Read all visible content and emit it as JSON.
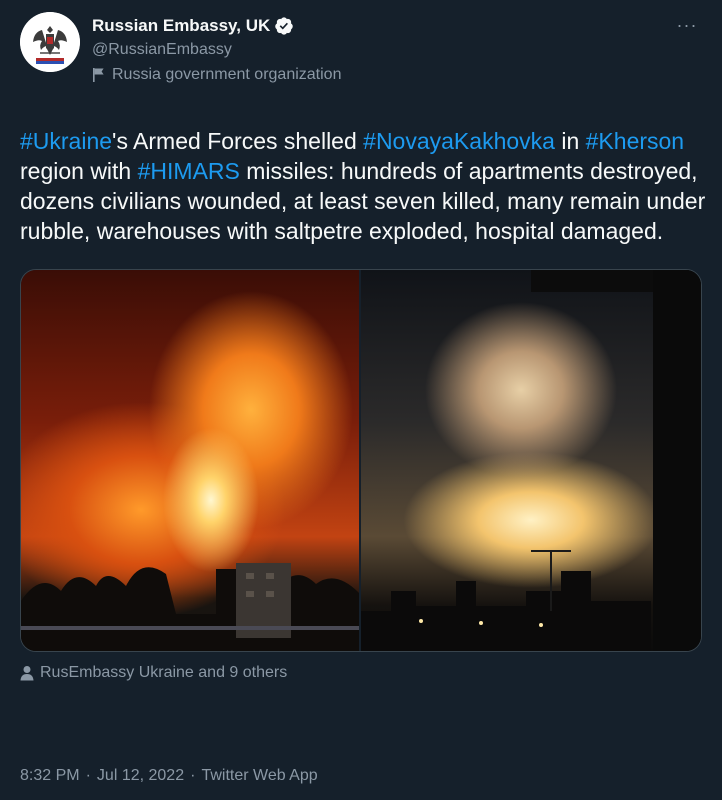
{
  "account": {
    "display_name": "Russian Embassy, UK",
    "handle": "@RussianEmbassy",
    "org_label": "Russia government organization",
    "verified": true
  },
  "tweet": {
    "segments": [
      {
        "text": "#Ukraine",
        "hashtag": true
      },
      {
        "text": "'s Armed Forces shelled ",
        "hashtag": false
      },
      {
        "text": "#NovayaKakhovka",
        "hashtag": true
      },
      {
        "text": " in ",
        "hashtag": false
      },
      {
        "text": "#Kherson",
        "hashtag": true
      },
      {
        "text": " region with ",
        "hashtag": false
      },
      {
        "text": "#HIMARS",
        "hashtag": true
      },
      {
        "text": " missiles: hundreds of apartments destroyed, dozens civilians wounded, at least seven killed, many remain under rubble, warehouses with saltpetre exploded, hospital damaged.",
        "hashtag": false
      }
    ]
  },
  "media": {
    "photos": [
      "night-fire-photo",
      "night-explosion-photo"
    ]
  },
  "tagged": {
    "text": "RusEmbassy Ukraine and 9 others"
  },
  "meta": {
    "time": "8:32 PM",
    "date": "Jul 12, 2022",
    "source": "Twitter Web App",
    "separator": "·"
  },
  "more_icon": "···",
  "colors": {
    "background": "#15202b",
    "text": "#f7f9f9",
    "secondary": "#8b98a5",
    "hashtag": "#1d9bf0"
  },
  "icons": [
    "verified-badge-icon",
    "government-flag-icon",
    "more-options-icon",
    "person-tag-icon",
    "coat-of-arms-icon"
  ]
}
